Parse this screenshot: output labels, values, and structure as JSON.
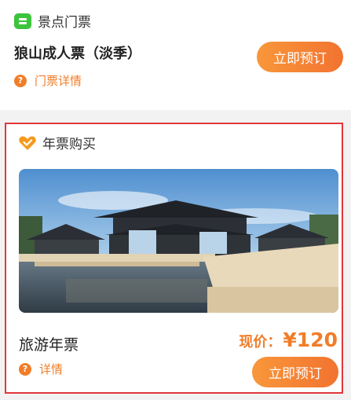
{
  "ticket_section": {
    "icon": "ticket-icon",
    "title": "景点门票",
    "ticket_name": "狼山成人票（淡季）",
    "detail_icon": "question-icon",
    "detail_text": "门票详情",
    "book_label": "立即预订"
  },
  "annual_section": {
    "icon": "heart-check-icon",
    "title": "年票购买",
    "photo": "scenic-pavilion-photo",
    "ticket_name": "旅游年票",
    "price_label": "现价：",
    "price_value": "¥120",
    "detail_icon": "question-icon",
    "detail_text": "详情",
    "book_label": "立即预订"
  },
  "colors": {
    "accent": "#f17d28",
    "highlight_border": "#e0373b",
    "ticket_icon": "#3cc43c"
  }
}
